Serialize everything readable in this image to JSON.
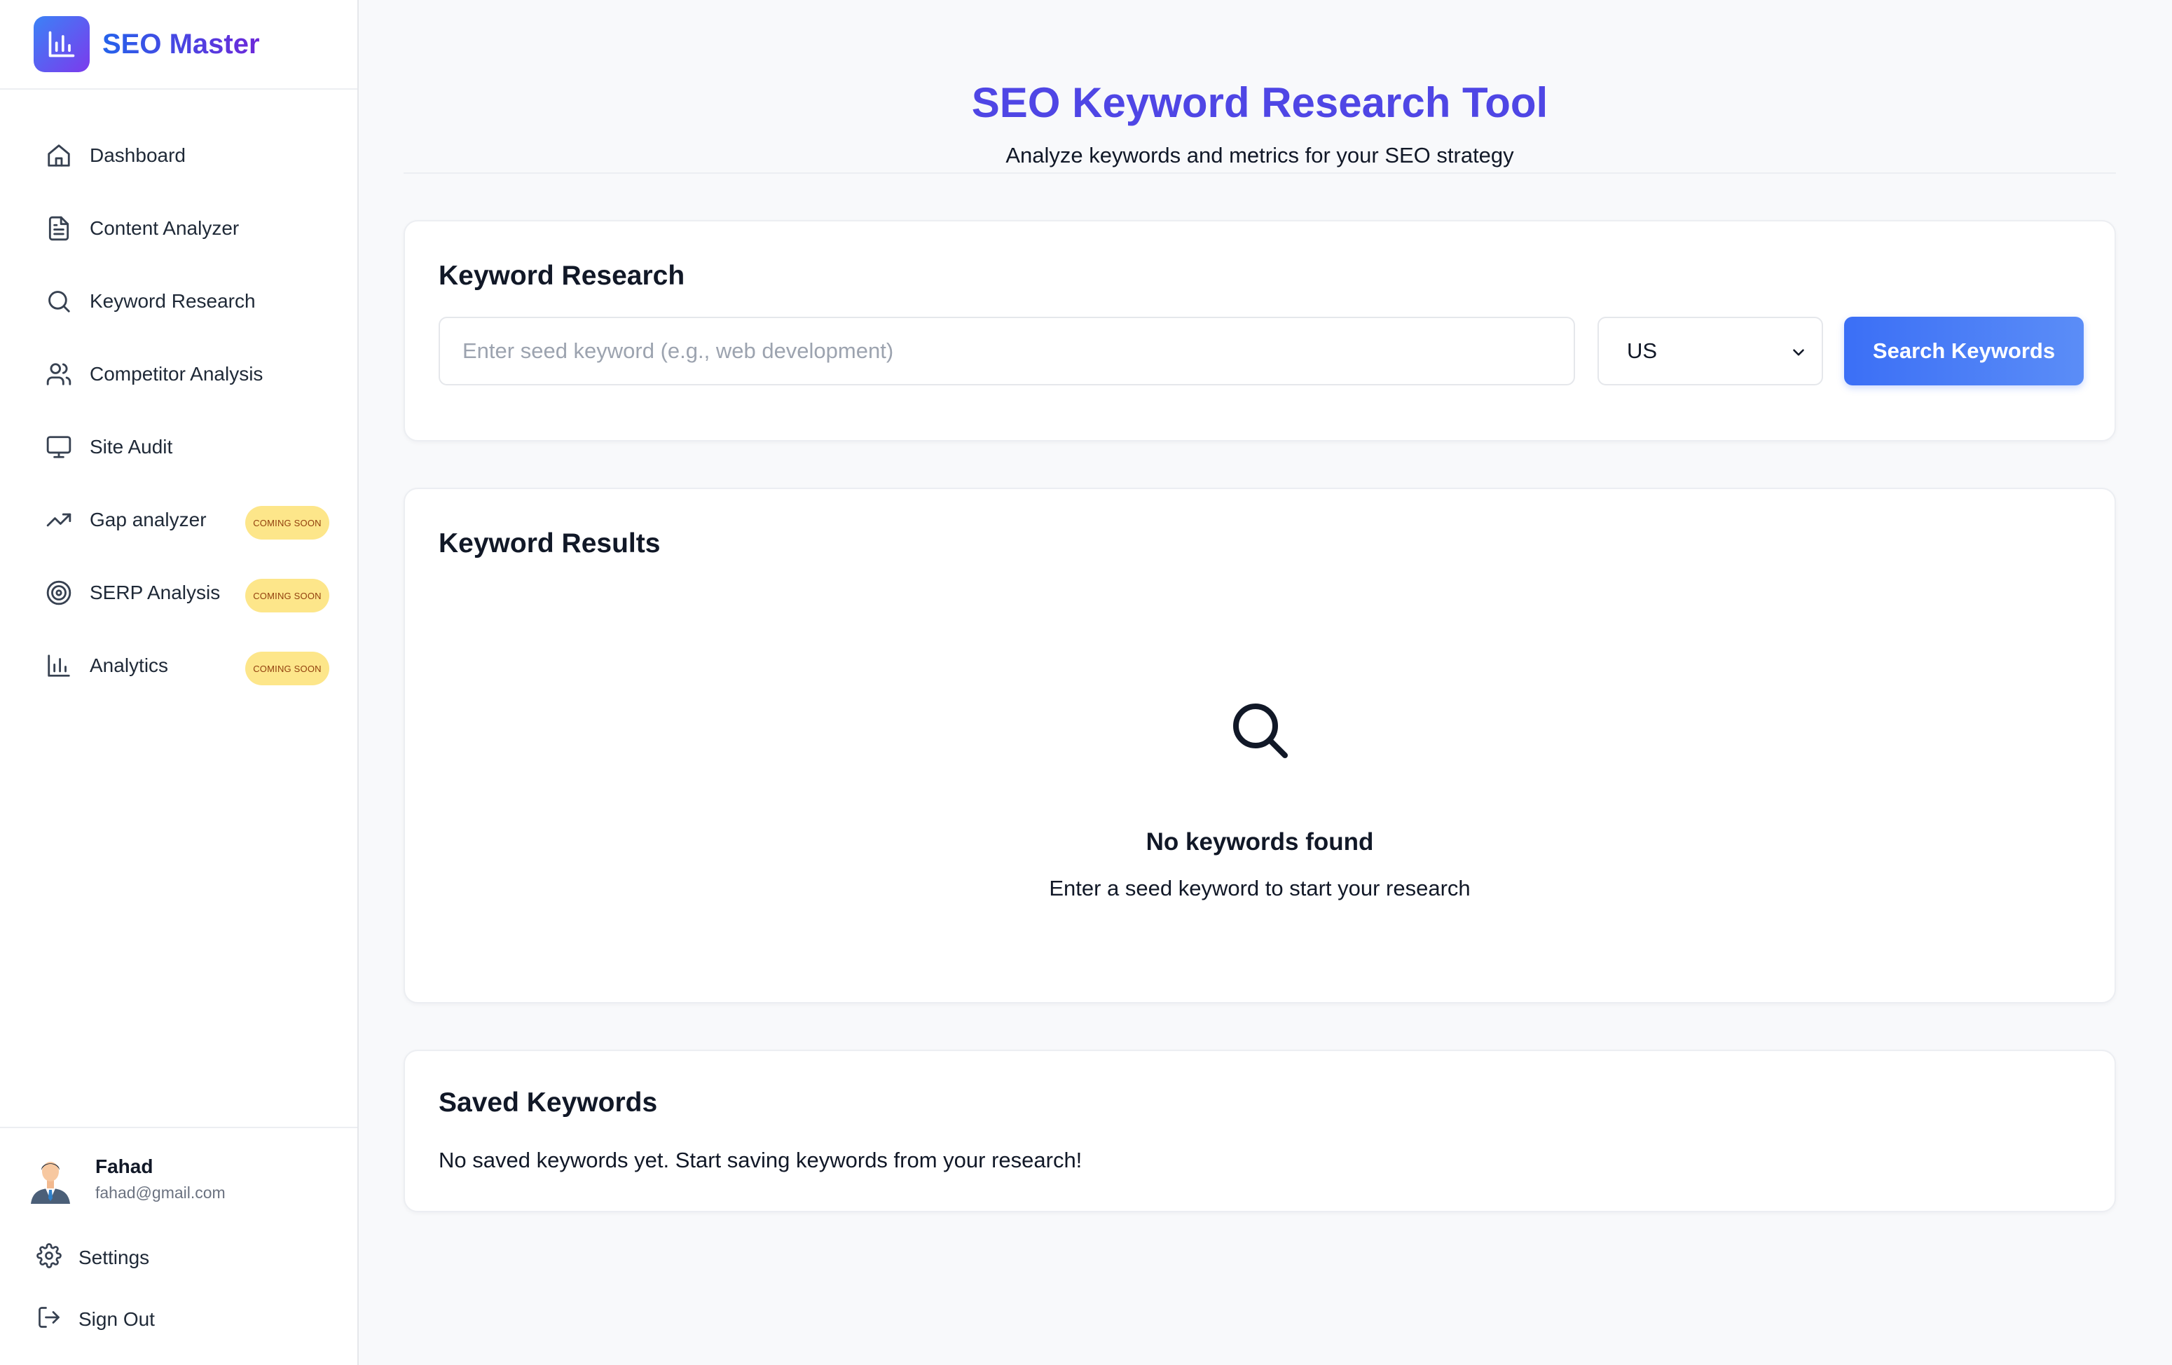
{
  "brand": {
    "name": "SEO Master"
  },
  "sidebar": {
    "items": [
      {
        "label": "Dashboard",
        "icon": "home-icon"
      },
      {
        "label": "Content Analyzer",
        "icon": "file-text-icon"
      },
      {
        "label": "Keyword Research",
        "icon": "search-icon"
      },
      {
        "label": "Competitor Analysis",
        "icon": "users-icon"
      },
      {
        "label": "Site Audit",
        "icon": "monitor-icon"
      },
      {
        "label": "Gap analyzer",
        "icon": "trending-up-icon",
        "badge": "COMING SOON"
      },
      {
        "label": "SERP Analysis",
        "icon": "target-icon",
        "badge": "COMING SOON"
      },
      {
        "label": "Analytics",
        "icon": "bar-chart-icon",
        "badge": "COMING SOON"
      }
    ]
  },
  "user": {
    "name": "Fahad",
    "email": "fahad@gmail.com"
  },
  "footer": {
    "settings_label": "Settings",
    "signout_label": "Sign Out"
  },
  "header": {
    "title": "SEO Keyword Research Tool",
    "subtitle": "Analyze keywords and metrics for your SEO strategy"
  },
  "research": {
    "title": "Keyword Research",
    "placeholder": "Enter seed keyword (e.g., web development)",
    "value": "",
    "country": "US",
    "button_label": "Search Keywords"
  },
  "results": {
    "title": "Keyword Results",
    "empty_title": "No keywords found",
    "empty_subtitle": "Enter a seed keyword to start your research"
  },
  "saved": {
    "title": "Saved Keywords",
    "empty_text": "No saved keywords yet. Start saving keywords from your research!"
  },
  "colors": {
    "accent": "#4f46e5",
    "button": "#3b6ff6",
    "badge_bg": "#fde68a",
    "badge_text": "#92400e"
  }
}
